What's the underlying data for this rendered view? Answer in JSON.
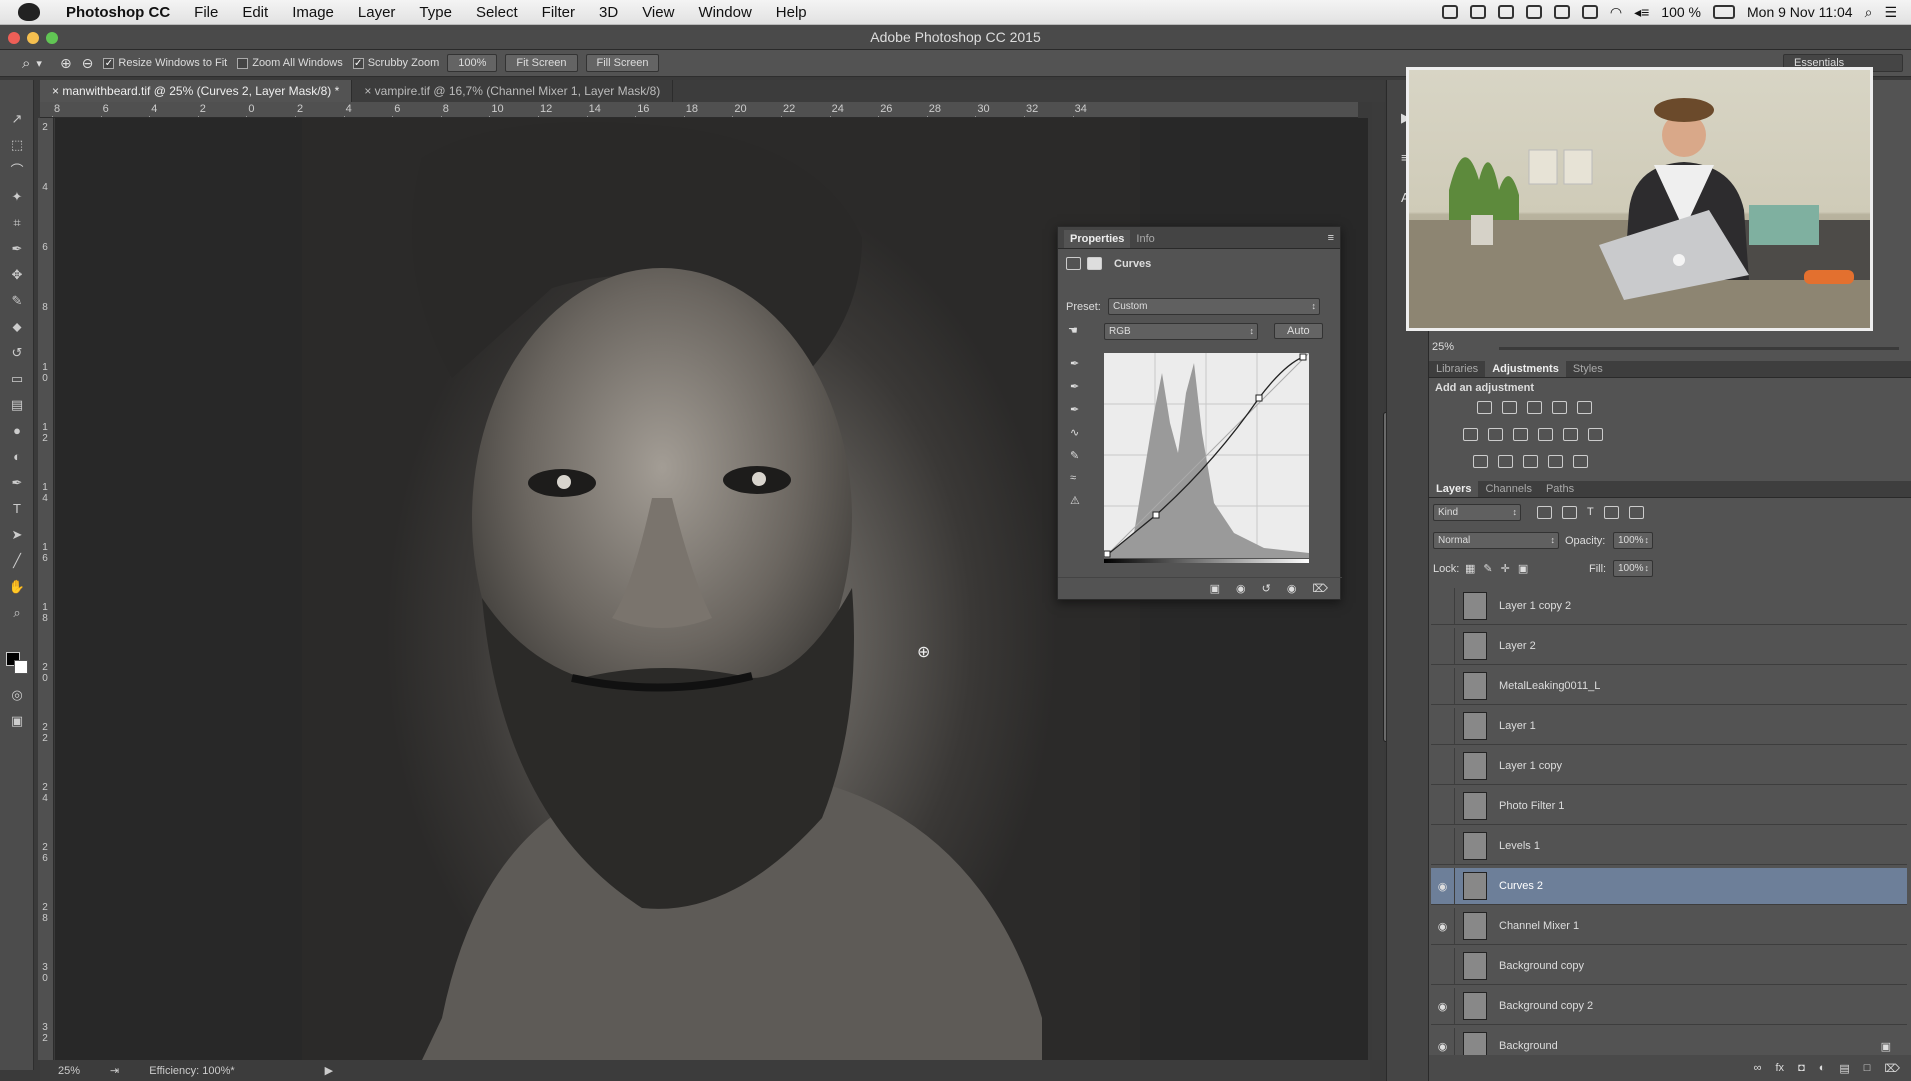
{
  "menubar": {
    "app": "Photoshop CC",
    "items": [
      "File",
      "Edit",
      "Image",
      "Layer",
      "Type",
      "Select",
      "Filter",
      "3D",
      "View",
      "Window",
      "Help"
    ],
    "battery": "100 %",
    "clock": "Mon 9 Nov  11:04"
  },
  "titlebar": {
    "title": "Adobe Photoshop CC 2015"
  },
  "options": {
    "resize_label": "Resize Windows to Fit",
    "zoom_all_label": "Zoom All Windows",
    "scrubby_label": "Scrubby Zoom",
    "zoom_value": "100%",
    "fit_screen": "Fit Screen",
    "fill_screen": "Fill Screen",
    "workspace": "Essentials"
  },
  "tabs": [
    {
      "label": "manwithbeard.tif @ 25% (Curves 2, Layer Mask/8) *"
    },
    {
      "label": "vampire.tif @ 16,7% (Channel Mixer 1, Layer Mask/8)"
    }
  ],
  "ruler": {
    "top": [
      "8",
      "6",
      "4",
      "2",
      "0",
      "2",
      "4",
      "6",
      "8",
      "10",
      "12",
      "14",
      "16",
      "18",
      "20",
      "22",
      "24",
      "26",
      "28",
      "30",
      "32",
      "34"
    ],
    "left": [
      "2",
      "4",
      "6",
      "8",
      "1 0",
      "1 2",
      "1 4",
      "1 6",
      "1 8",
      "2 0",
      "2 2",
      "2 4",
      "2 6",
      "2 8",
      "3 0",
      "3 2"
    ]
  },
  "status": {
    "zoom": "25%",
    "efficiency": "Efficiency: 100%*"
  },
  "properties": {
    "tabs": [
      "Properties",
      "Info"
    ],
    "type": "Curves",
    "preset_label": "Preset:",
    "preset_value": "Custom",
    "channel": "RGB",
    "auto": "Auto"
  },
  "navigator": {
    "zoom": "25%"
  },
  "adjustments": {
    "tabs": [
      "Libraries",
      "Adjustments",
      "Styles"
    ],
    "heading": "Add an adjustment"
  },
  "layers": {
    "tabs": [
      "Layers",
      "Channels",
      "Paths"
    ],
    "kind": "Kind",
    "blend": "Normal",
    "opacity_label": "Opacity:",
    "opacity": "100%",
    "lock_label": "Lock:",
    "fill_label": "Fill:",
    "fill": "100%",
    "items": [
      {
        "name": "Layer 1 copy 2",
        "visible": false,
        "selected": false
      },
      {
        "name": "Layer 2",
        "visible": false,
        "selected": false
      },
      {
        "name": "MetalLeaking0011_L",
        "visible": false,
        "selected": false
      },
      {
        "name": "Layer 1",
        "visible": false,
        "selected": false
      },
      {
        "name": "Layer 1 copy",
        "visible": false,
        "selected": false
      },
      {
        "name": "Photo Filter 1",
        "visible": false,
        "selected": false
      },
      {
        "name": "Levels 1",
        "visible": false,
        "selected": false
      },
      {
        "name": "Curves 2",
        "visible": true,
        "selected": true
      },
      {
        "name": "Channel Mixer 1",
        "visible": true,
        "selected": false
      },
      {
        "name": "Background copy",
        "visible": false,
        "selected": false
      },
      {
        "name": "Background copy 2",
        "visible": true,
        "selected": false
      },
      {
        "name": "Background",
        "visible": true,
        "selected": false
      }
    ]
  },
  "colors": {
    "accent": "#6d7f99",
    "panel": "#535353",
    "canvas": "#282828"
  }
}
